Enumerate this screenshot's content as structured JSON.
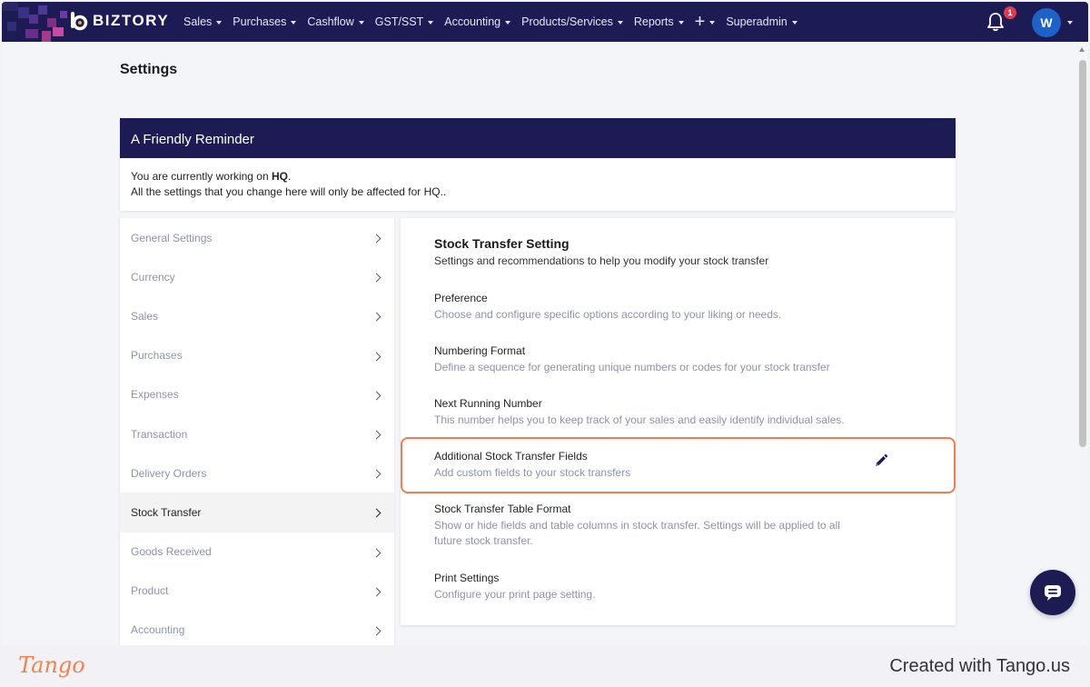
{
  "brand": {
    "name": "BIZTORY"
  },
  "nav": {
    "menu": [
      "Sales",
      "Purchases",
      "Cashflow",
      "GST/SST",
      "Accounting",
      "Products/Services",
      "Reports",
      "",
      "Superadmin"
    ],
    "notification_count": "1",
    "avatar_initial": "W"
  },
  "page": {
    "title": "Settings"
  },
  "reminder": {
    "title": "A Friendly Reminder",
    "line1_prefix": "You are currently working on ",
    "location": "HQ",
    "line1_suffix": ".",
    "line2": "All the settings that you change here will only be affected for HQ.."
  },
  "sidebar": {
    "items": [
      {
        "label": "General Settings"
      },
      {
        "label": "Currency"
      },
      {
        "label": "Sales"
      },
      {
        "label": "Purchases"
      },
      {
        "label": "Expenses"
      },
      {
        "label": "Transaction"
      },
      {
        "label": "Delivery Orders"
      },
      {
        "label": "Stock Transfer",
        "active": true
      },
      {
        "label": "Goods Received"
      },
      {
        "label": "Product"
      },
      {
        "label": "Accounting"
      }
    ]
  },
  "panel": {
    "title": "Stock Transfer Setting",
    "subtitle": "Settings and recommendations to help you modify your stock transfer",
    "options": [
      {
        "title": "Preference",
        "desc": "Choose and configure specific options according to your liking or needs."
      },
      {
        "title": "Numbering Format",
        "desc": "Define a sequence for generating unique numbers or codes for your stock transfer"
      },
      {
        "title": "Next Running Number",
        "desc": "This number helps you to keep track of your sales and easily identify individual sales."
      },
      {
        "title": "Additional Stock Transfer Fields",
        "desc": "Add custom fields to your stock transfers"
      },
      {
        "title": "Stock Transfer Table Format",
        "desc": "Show or hide fields and table columns in stock transfer. Settings will be applied to all future stock transfer."
      },
      {
        "title": "Print Settings",
        "desc": "Configure your print page setting."
      }
    ]
  },
  "footer": {
    "logo": "Tango",
    "credit": "Created with Tango.us"
  },
  "colors": {
    "navy": "#1d1b54",
    "highlight": "#ef7d4f",
    "muted": "#8d93a6",
    "badge": "#e53950",
    "avatar": "#1d62c6"
  }
}
